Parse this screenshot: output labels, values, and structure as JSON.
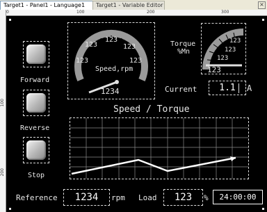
{
  "tabs": [
    {
      "label": "Target1 - Panel1 - Language1"
    },
    {
      "label": "Target1 - Variable Editor"
    }
  ],
  "tab_close_glyph": "×",
  "ruler": {
    "h_labels": [
      "0",
      "100",
      "200",
      "300"
    ],
    "v_labels": [
      "100",
      "200"
    ]
  },
  "buttons": [
    {
      "label": "Forward"
    },
    {
      "label": "Reverse"
    },
    {
      "label": "Stop"
    }
  ],
  "speed_gauge": {
    "label": "Speed,rpm",
    "scale_value": "123",
    "display_value": "1234"
  },
  "torque_gauge": {
    "label_line1": "Torque",
    "label_line2": "%Mn",
    "scale_value": "123",
    "display_value": "123"
  },
  "current": {
    "label": "Current",
    "value": "1.1",
    "unit": "A"
  },
  "chart": {
    "title": "Speed / Torque"
  },
  "bottom": {
    "reference_label": "Reference",
    "reference_value": "1234",
    "rpm_unit": "rpm",
    "load_label": "Load",
    "load_value": "123",
    "percent": "%",
    "time": "24:00:00"
  },
  "colors": {
    "panel_bg": "#000000",
    "text": "#e8e8e8",
    "gauge_track": "#9a9a9a"
  }
}
